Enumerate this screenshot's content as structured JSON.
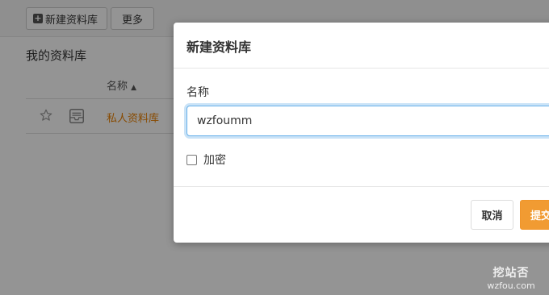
{
  "toolbar": {
    "new_library_label": "新建资料库",
    "more_label": "更多"
  },
  "libraries": {
    "section_title": "我的资料库",
    "column_name": "名称",
    "rows": [
      {
        "name": "私人资料库"
      }
    ]
  },
  "dialog": {
    "title": "新建资料库",
    "name_label": "名称",
    "name_value": "wzfoumm",
    "encrypt_label": "加密",
    "encrypt_checked": false,
    "cancel_label": "取消",
    "submit_label": "提交"
  },
  "watermark": {
    "text_cn": "挖站否",
    "text_en": "wzfou.com"
  },
  "colors": {
    "accent": "#f19b32",
    "link": "#eb8205",
    "focus": "#66afe9"
  }
}
